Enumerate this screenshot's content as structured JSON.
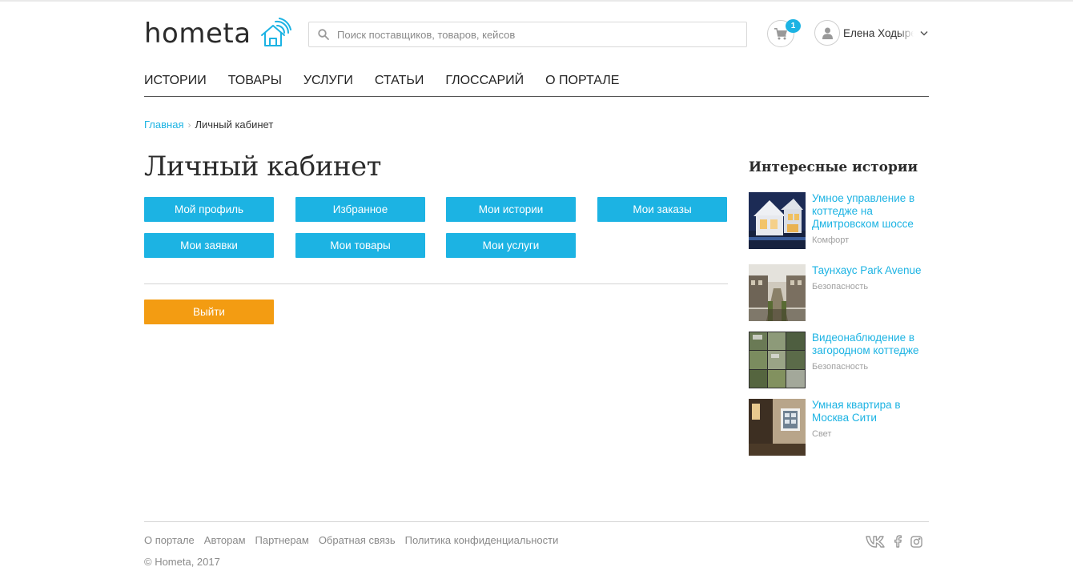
{
  "header": {
    "logo_text": "hometa",
    "search_placeholder": "Поиск поставщиков, товаров, кейсов",
    "cart_count": "1",
    "user_name": "Елена Ходырева"
  },
  "nav": {
    "items": [
      {
        "label": "ИСТОРИИ"
      },
      {
        "label": "ТОВАРЫ"
      },
      {
        "label": "УСЛУГИ"
      },
      {
        "label": "СТАТЬИ"
      },
      {
        "label": "ГЛОССАРИЙ"
      },
      {
        "label": "О ПОРТАЛЕ"
      }
    ]
  },
  "breadcrumb": {
    "home": "Главная",
    "separator": "›",
    "current": "Личный кабинет"
  },
  "page": {
    "title": "Личный кабинет",
    "buttons": [
      {
        "label": "Мой профиль"
      },
      {
        "label": "Избранное"
      },
      {
        "label": "Мои истории"
      },
      {
        "label": "Мои заказы"
      },
      {
        "label": "Мои заявки"
      },
      {
        "label": "Мои товары"
      },
      {
        "label": "Мои услуги"
      }
    ],
    "logout_label": "Выйти"
  },
  "sidebar": {
    "title": "Интересные истории",
    "stories": [
      {
        "title": "Умное управление в коттедже на Дмитровском шоссе",
        "category": "Комфорт"
      },
      {
        "title": "Таунхаус Park Avenue",
        "category": "Безопасность"
      },
      {
        "title": "Видеонаблюдение в загородном коттедже",
        "category": "Безопасность"
      },
      {
        "title": "Умная квартира в Москва Сити",
        "category": "Свет"
      }
    ]
  },
  "footer": {
    "links": [
      {
        "label": "О портале"
      },
      {
        "label": "Авторам"
      },
      {
        "label": "Партнерам"
      },
      {
        "label": "Обратная связь"
      },
      {
        "label": "Политика конфиденциальности"
      }
    ],
    "copyright": "© Hometa, 2017",
    "social_icons": [
      "vk-icon",
      "facebook-icon",
      "instagram-icon"
    ]
  },
  "colors": {
    "accent": "#1cb3e3",
    "logout": "#f39c12",
    "text": "#222222",
    "muted": "#8a8a8a"
  }
}
